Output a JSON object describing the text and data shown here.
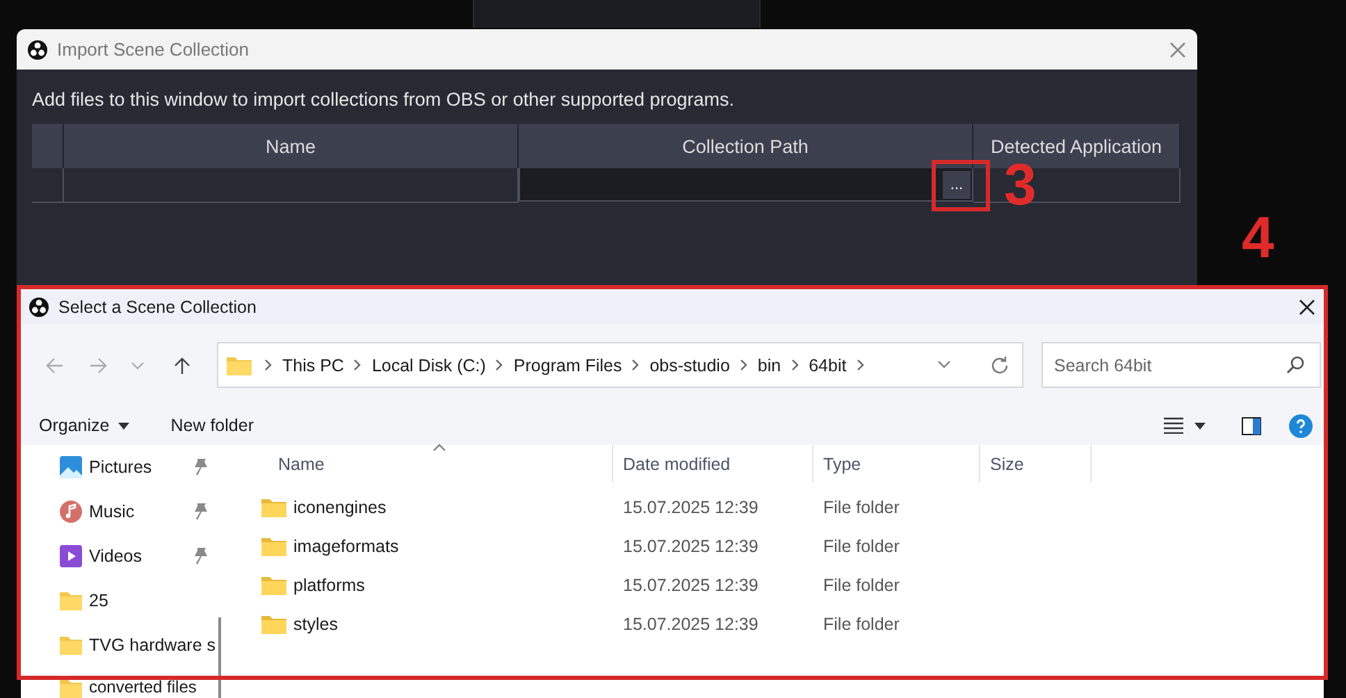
{
  "import_dialog": {
    "title": "Import Scene Collection",
    "instructions": "Add files to this window to import collections from OBS or other supported programs.",
    "columns": [
      {
        "label": "Name"
      },
      {
        "label": "Collection Path"
      },
      {
        "label": "Detected Application"
      }
    ],
    "rows": [
      {
        "browse_button": "..."
      }
    ]
  },
  "annotation_marks": {
    "browse_marker": "3",
    "dialog_marker": "4"
  },
  "file_dialog": {
    "title": "Select a Scene Collection",
    "breadcrumb": [
      "This PC",
      "Local Disk (C:)",
      "Program Files",
      "obs-studio",
      "bin",
      "64bit"
    ],
    "search": {
      "placeholder": "Search 64bit"
    },
    "toolbar": {
      "organize": "Organize",
      "new_folder": "New folder"
    },
    "sidebar": {
      "items": [
        {
          "label": "Pictures",
          "kind": "pictures",
          "pinned": true
        },
        {
          "label": "Music",
          "kind": "music",
          "pinned": true
        },
        {
          "label": "Videos",
          "kind": "videos",
          "pinned": true
        },
        {
          "label": "25",
          "kind": "folder",
          "pinned": false
        },
        {
          "label": "TVG hardware s",
          "kind": "folder",
          "pinned": false
        },
        {
          "label": "converted files",
          "kind": "folder",
          "pinned": false
        }
      ]
    },
    "columns": [
      {
        "label": "Name",
        "sorted": true
      },
      {
        "label": "Date modified",
        "sorted": false
      },
      {
        "label": "Type",
        "sorted": false
      },
      {
        "label": "Size",
        "sorted": false
      }
    ],
    "rows": [
      {
        "name": "iconengines",
        "date_modified": "15.07.2025 12:39",
        "type": "File folder"
      },
      {
        "name": "imageformats",
        "date_modified": "15.07.2025 12:39",
        "type": "File folder"
      },
      {
        "name": "platforms",
        "date_modified": "15.07.2025 12:39",
        "type": "File folder"
      },
      {
        "name": "styles",
        "date_modified": "15.07.2025 12:39",
        "type": "File folder"
      }
    ]
  }
}
